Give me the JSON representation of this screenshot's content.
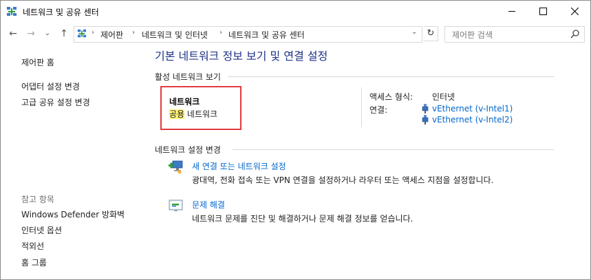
{
  "window": {
    "title": "네트워크 및 공유 센터"
  },
  "nav": {
    "back": "←",
    "forward": "→",
    "recent": "⌄",
    "up": "↑"
  },
  "breadcrumb": [
    "제어판",
    "네트워크 및 인터넷",
    "네트워크 및 공유 센터"
  ],
  "search": {
    "placeholder": "제어판 검색"
  },
  "sidebar": {
    "home": "제어판 홈",
    "items": [
      "어댑터 설정 변경",
      "고급 공유 설정 변경"
    ],
    "see_also_header": "참고 항목",
    "see_also": [
      "Windows Defender 방화벽",
      "인터넷 옵션",
      "적외선",
      "홈 그룹"
    ]
  },
  "main": {
    "title": "기본 네트워크 정보 보기 및 연결 설정",
    "active_header": "활성 네트워크 보기",
    "network": {
      "name": "네트워크",
      "type_highlight": "공용",
      "type_rest": " 네트워크",
      "access_type_label": "액세스 형식:",
      "access_type_value": "인터넷",
      "connections_label": "연결:",
      "connections": [
        "vEthernet (v-Intel1)",
        "vEthernet (v-Intel2)"
      ]
    },
    "change_header": "네트워크 설정 변경",
    "tasks": [
      {
        "link": "새 연결 또는 네트워크 설정",
        "desc": "광대역, 전화 접속 또는 VPN 연결을 설정하거나 라우터 또는 액세스 지점을 설정합니다.",
        "icon": "new-connection-icon"
      },
      {
        "link": "문제 해결",
        "desc": "네트워크 문제를 진단 및 해결하거나 문제 해결 정보를 얻습니다.",
        "icon": "troubleshoot-icon"
      }
    ]
  },
  "colors": {
    "accent": "#1e3287",
    "link": "#0066cc",
    "highlight_box": "#e03c3c",
    "marker": "#fff27a"
  }
}
